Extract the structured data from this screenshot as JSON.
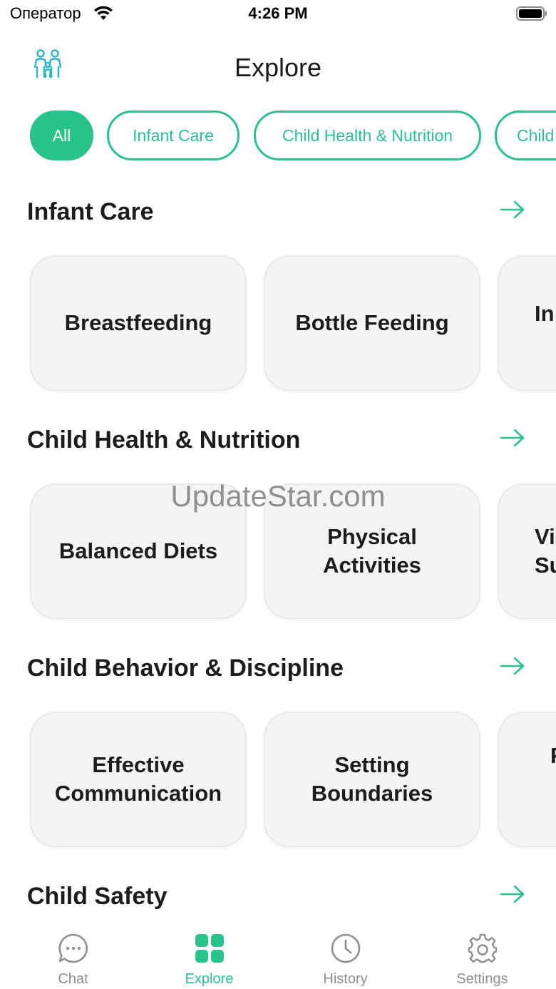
{
  "status_bar": {
    "carrier": "Оператор",
    "time": "4:26 PM"
  },
  "header": {
    "title": "Explore",
    "icon": "family-icon"
  },
  "filters": {
    "chips": [
      "All",
      "Infant Care",
      "Child Health & Nutrition",
      "Child"
    ],
    "selected": "All"
  },
  "sections": [
    {
      "title": "Infant Care",
      "cards": [
        "Breastfeeding",
        "Bottle Feeding",
        "In"
      ]
    },
    {
      "title": "Child Health & Nutrition",
      "cards": [
        "Balanced Diets",
        "Physical Activities",
        "Vi Su"
      ]
    },
    {
      "title": "Child Behavior & Discipline",
      "cards": [
        "Effective Communication",
        "Setting Boundaries",
        "F"
      ]
    },
    {
      "title": "Child Safety",
      "cards": []
    }
  ],
  "watermark": "UpdateStar.com",
  "tab_bar": {
    "tabs": [
      {
        "label": "Chat",
        "icon": "chat-bubble-icon"
      },
      {
        "label": "Explore",
        "icon": "grid-icon"
      },
      {
        "label": "History",
        "icon": "clock-icon"
      },
      {
        "label": "Settings",
        "icon": "gear-icon"
      }
    ],
    "active": "Explore"
  },
  "colors": {
    "accent": "#28c38a",
    "card_bg": "#f4f4f4",
    "inactive": "#8e8e93",
    "text": "#1c1c1e"
  }
}
